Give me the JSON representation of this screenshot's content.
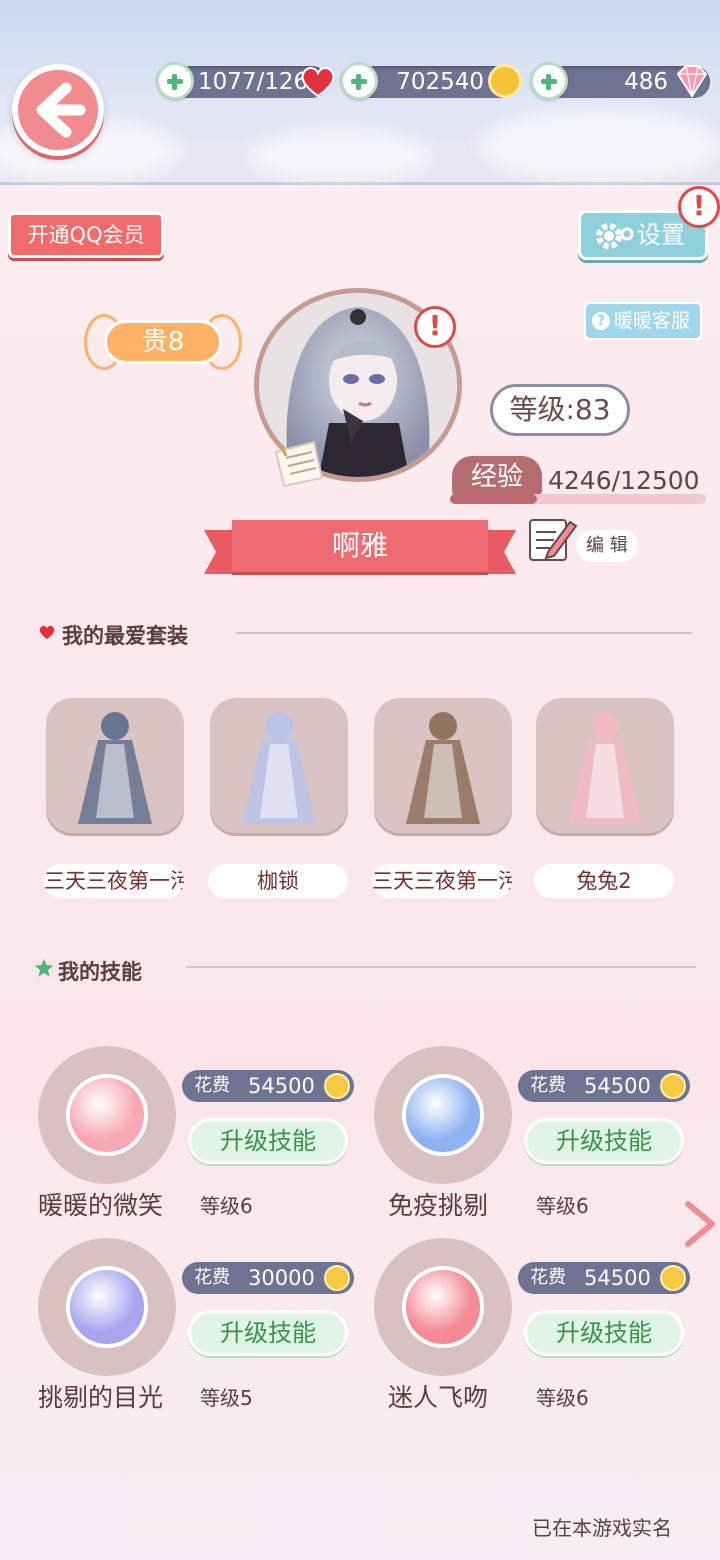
{
  "header": {
    "stamina": "1077/126",
    "coins": "702540",
    "diamonds": "486"
  },
  "buttons": {
    "qq_vip": "开通QQ会员",
    "settings": "设置",
    "customer_service": "暖暖客服",
    "alert": "!"
  },
  "profile": {
    "vip_level": "贵8",
    "level": "等级:83",
    "exp_label": "经验",
    "exp_value": "4246/12500",
    "exp_progress": 0.34,
    "name": "啊雅",
    "edit": "编 辑"
  },
  "favorites": {
    "title": "我的最爱套装",
    "items": [
      {
        "name": "三天三夜第一污",
        "color": "#5b6b8c"
      },
      {
        "name": "枷锁",
        "color": "#b8c3ec"
      },
      {
        "name": "三天三夜第一污",
        "color": "#8a6a55"
      },
      {
        "name": "兔兔2",
        "color": "#f1b9c3"
      }
    ]
  },
  "skills": {
    "title": "我的技能",
    "cost_label": "花费",
    "upgrade_label": "升级技能",
    "items": [
      {
        "name": "暖暖的微笑",
        "level": "等级6",
        "cost": "54500",
        "orb_color": "#f7a8b2"
      },
      {
        "name": "免疫挑剔",
        "level": "等级6",
        "cost": "54500",
        "orb_color": "#8fb3f2"
      },
      {
        "name": "挑剔的目光",
        "level": "等级5",
        "cost": "30000",
        "orb_color": "#a8a6f0"
      },
      {
        "name": "迷人飞吻",
        "level": "等级6",
        "cost": "54500",
        "orb_color": "#f48a95"
      }
    ]
  },
  "footer": {
    "realname": "已在本游戏实名"
  }
}
